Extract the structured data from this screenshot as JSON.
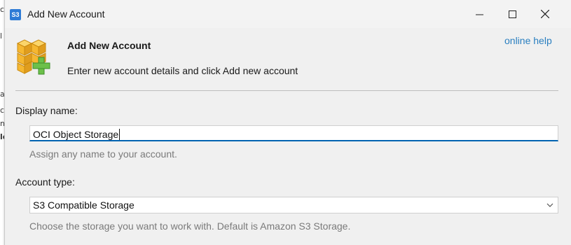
{
  "background": {
    "chars": [
      "c",
      "l",
      "a",
      "c",
      "n",
      "le"
    ]
  },
  "window": {
    "title": "Add New Account",
    "app_icon_text": "S3",
    "minimize_icon": "minimize-icon",
    "maximize_icon": "maximize-icon",
    "close_icon": "close-icon"
  },
  "header": {
    "title": "Add New Account",
    "subtitle": "Enter new account details and click Add new account",
    "help_link": "online help",
    "icon": "boxes-add-icon"
  },
  "form": {
    "display_name_label": "Display name:",
    "display_name_value": "OCI Object Storage",
    "display_name_hint": "Assign any name to your account.",
    "account_type_label": "Account type:",
    "account_type_value": "S3 Compatible Storage",
    "account_type_hint": "Choose the storage you want to work with. Default is Amazon S3 Storage."
  },
  "colors": {
    "accent": "#0063b1",
    "link": "#2a7fc0",
    "box": "#f5b731",
    "plus": "#6cc04a"
  }
}
